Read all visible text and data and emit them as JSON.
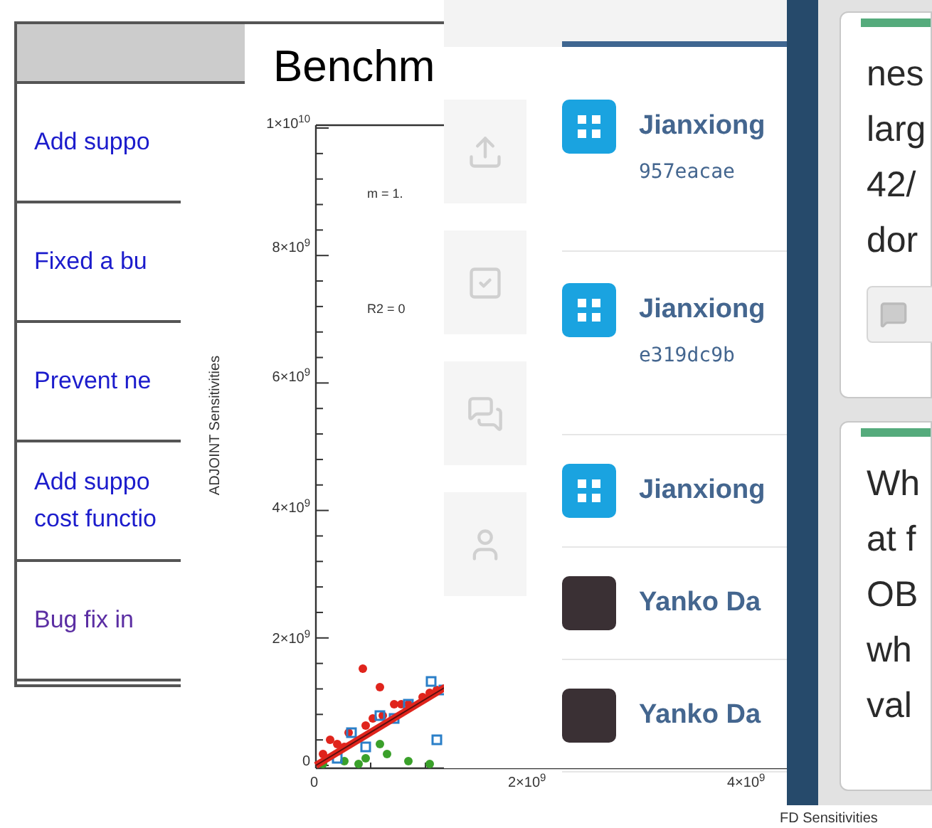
{
  "table": {
    "rows": [
      {
        "text": "Add suppo",
        "visited": false
      },
      {
        "text": "Fixed a bu",
        "visited": false
      },
      {
        "text": "Prevent ne",
        "visited": false
      },
      {
        "text": "Add suppo\ncost functio",
        "visited": false
      },
      {
        "text": "Bug fix in",
        "visited": true
      }
    ]
  },
  "chart": {
    "title": "Benchm",
    "ylabel": "ADJOINT Sensitivities",
    "xlabel": "FD Sensitivities",
    "yticks": [
      "1×10$^{10}$",
      "8×10$^{9}$",
      "6×10$^{9}$",
      "4×10$^{9}$",
      "2×10$^{9}$",
      "0"
    ],
    "xticks": [
      "0",
      "2×10$^{9}$",
      "4×10$^{9}$"
    ],
    "annotations": [
      "m = 1.",
      "R2 = 0"
    ]
  },
  "commits": {
    "tools": [
      {
        "kind": "upload"
      },
      {
        "kind": "checklist"
      },
      {
        "kind": "comments"
      },
      {
        "kind": "user"
      }
    ],
    "items": [
      {
        "kind": "identicon",
        "name": "Jianxiong",
        "hash": "957eacae"
      },
      {
        "kind": "identicon",
        "name": "Jianxiong",
        "hash": "e319dc9b"
      },
      {
        "kind": "identicon",
        "name": "Jianxiong"
      },
      {
        "kind": "photo",
        "name": "Yanko Da"
      },
      {
        "kind": "photo",
        "name": "Yanko Da"
      }
    ]
  },
  "cards": [
    {
      "lines": [
        "nes",
        "larg",
        "42/",
        "dor"
      ],
      "comment_button": true
    },
    {
      "lines": [
        "Wh",
        "at f",
        "OB",
        "wh",
        "val"
      ],
      "comment_button": false
    }
  ]
}
